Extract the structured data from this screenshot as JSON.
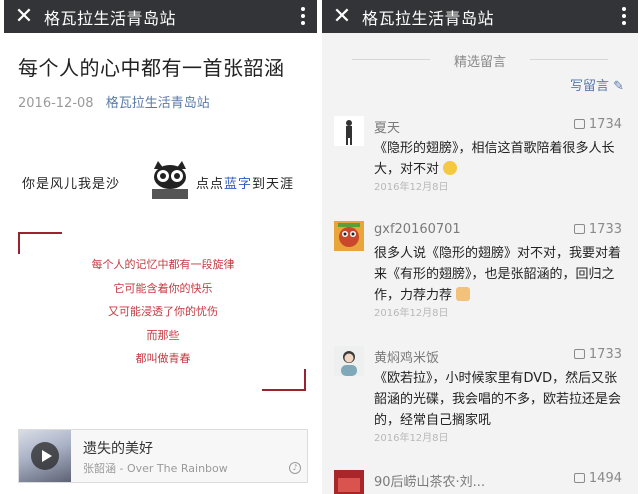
{
  "left": {
    "topbar": {
      "close_icon": "close-icon",
      "title": "格瓦拉生活青岛站",
      "more_icon": "more-vertical-icon"
    },
    "article": {
      "title": "每个人的心中都有一首张韶涵",
      "date": "2016-12-08",
      "account": "格瓦拉生活青岛站",
      "banner_left": "你是风儿我是沙",
      "banner_right_prefix": "点点",
      "banner_right_highlight": "蓝字",
      "banner_right_suffix": "到天涯",
      "poem": [
        "每个人的记忆中都有一段旋律",
        "它可能含着你的快乐",
        "又可能浸透了你的忧伤",
        "而那些",
        "都叫做青春"
      ],
      "music": {
        "song": "遗失的美好",
        "artist": "张韶涵 - Over The Rainbow"
      }
    }
  },
  "right": {
    "topbar": {
      "close_icon": "close-icon",
      "title": "格瓦拉生活青岛站",
      "more_icon": "more-vertical-icon"
    },
    "section_title": "精选留言",
    "write_label": "写留言",
    "comments": [
      {
        "name": "夏天",
        "likes": "1734",
        "text": "《隐形的翅膀》，相信这首歌陪着很多人长大，对不对",
        "date": "2016年12月8日"
      },
      {
        "name": "gxf20160701",
        "likes": "1733",
        "text": "很多人说《隐形的翅膀》对不对，我要对着来《有形的翅膀》，也是张韶涵的，回归之作，力荐力荐",
        "date": "2016年12月8日"
      },
      {
        "name": "黄焖鸡米饭",
        "likes": "1733",
        "text": "《欧若拉》，小时候家里有DVD，然后又张韶涵的光碟，我会唱的不多，欧若拉还是会的，经常自己搁家吼",
        "date": "2016年12月8日"
      },
      {
        "name": "90后崂山茶农·刘...",
        "likes": "1494"
      }
    ]
  }
}
